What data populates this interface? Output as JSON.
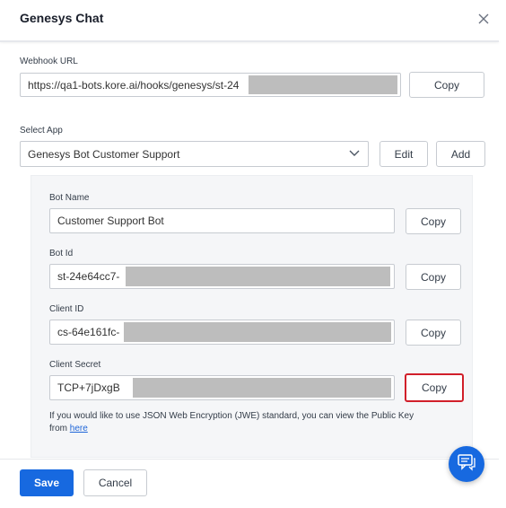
{
  "dialog": {
    "title": "Genesys Chat"
  },
  "webhook": {
    "label": "Webhook URL",
    "value": "https://qa1-bots.kore.ai/hooks/genesys/st-24",
    "copy_label": "Copy"
  },
  "select_app": {
    "label": "Select App",
    "selected": "Genesys Bot Customer Support",
    "edit_label": "Edit",
    "add_label": "Add"
  },
  "bot_name": {
    "label": "Bot Name",
    "value": "Customer Support Bot",
    "copy_label": "Copy"
  },
  "bot_id": {
    "label": "Bot Id",
    "value": "st-24e64cc7-",
    "copy_label": "Copy"
  },
  "client_id": {
    "label": "Client ID",
    "value": "cs-64e161fc-",
    "copy_label": "Copy"
  },
  "client_secret": {
    "label": "Client Secret",
    "value": "TCP+7jDxgB",
    "copy_label": "Copy"
  },
  "jwe_note": {
    "line1": "If you would like to use JSON Web Encryption (JWE) standard, you can view the Public Key",
    "prefix": "from ",
    "link": "here"
  },
  "footer": {
    "save_label": "Save",
    "cancel_label": "Cancel"
  },
  "colors": {
    "primary": "#1769e0",
    "highlight": "#d11f2a",
    "mask": "#bdbdbd"
  },
  "icons": {
    "close": "close-icon",
    "dropdown": "chevron-down-icon",
    "chat": "chat-icon"
  }
}
